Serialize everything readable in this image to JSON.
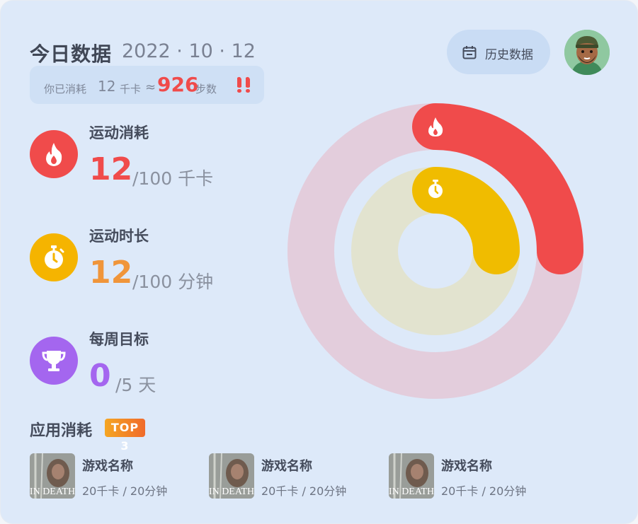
{
  "header": {
    "title": "今日数据",
    "date": "2022 · 10 · 12",
    "history_label": "历史数据",
    "history_icon": "calendar-icon"
  },
  "summary": {
    "prefix": "你已消耗",
    "kcal": "12",
    "kcal_unit": "千卡",
    "approx": "≈",
    "steps": "926",
    "steps_unit": "步数",
    "icon": "footprints-icon",
    "steps_color": "#f04b4b"
  },
  "metrics": [
    {
      "title": "运动消耗",
      "value": "12",
      "goal": "/100 千卡",
      "icon": "flame-icon",
      "color": "#f04b4b",
      "progress": 0.25
    },
    {
      "title": "运动时长",
      "value": "12",
      "goal": "/100 分钟",
      "icon": "stopwatch-icon",
      "color": "#f5b400",
      "value_color": "#f0953a",
      "progress": 0.25
    },
    {
      "title": "每周目标",
      "value": "0",
      "goal": "/5 天",
      "icon": "trophy-icon",
      "color": "#a466ef",
      "progress": 0
    }
  ],
  "apps": {
    "title": "应用消耗",
    "badge": "TOP 3",
    "items": [
      {
        "name": "游戏名称",
        "meta": "20千卡 / 20分钟",
        "thumb_text": "IN DEATH"
      },
      {
        "name": "游戏名称",
        "meta": "20千卡 / 20分钟",
        "thumb_text": "IN DEATH"
      },
      {
        "name": "游戏名称",
        "meta": "20千卡 / 20分钟",
        "thumb_text": "IN DEATH"
      }
    ]
  },
  "colors": {
    "background": "#dde9f9",
    "outer_track": "#e3cddc",
    "inner_track": "#e2e3cf",
    "red": "#f04b4b",
    "yellow": "#f0bc00",
    "purple": "#a466ef"
  }
}
